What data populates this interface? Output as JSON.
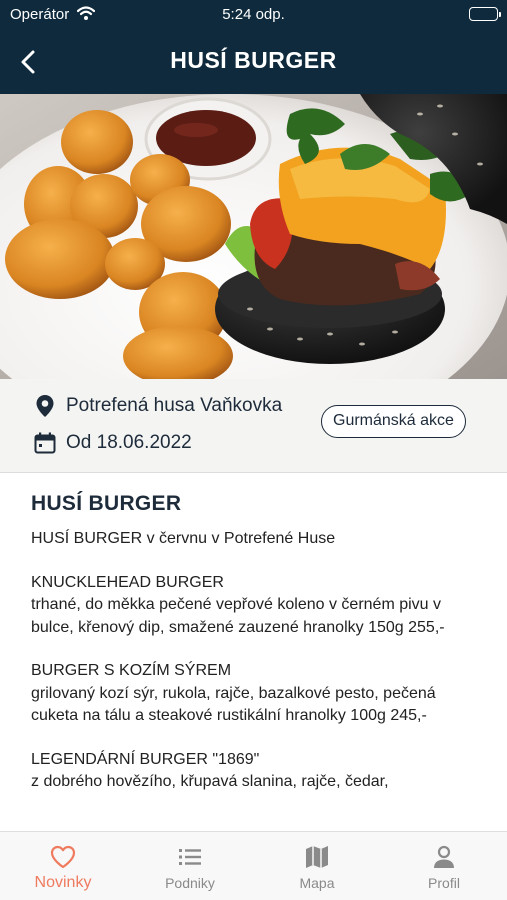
{
  "status": {
    "carrier": "Operátor",
    "time": "5:24 odp."
  },
  "nav": {
    "title": "HUSÍ BURGER"
  },
  "info": {
    "venue": "Potrefená husa Vaňkovka",
    "date": "Od 18.06.2022",
    "tag": "Gurmánská akce"
  },
  "article": {
    "heading": "HUSÍ BURGER",
    "paragraphs": [
      {
        "title": "HUSÍ BURGER v červnu v Potrefené Huse",
        "body": ""
      },
      {
        "title": "KNUCKLEHEAD BURGER",
        "body": "trhané, do měkka pečené vepřové koleno v černém pivu v bulce, křenový dip, smažené zauzené hranolky 150g 255,-"
      },
      {
        "title": "BURGER S KOZÍM SÝREM",
        "body": "grilovaný kozí sýr, rukola, rajče, bazalkové pesto, pečená cuketa na tálu a steakové rustikální hranolky 100g 245,-"
      },
      {
        "title": "LEGENDÁRNÍ BURGER \"1869\"",
        "body": "z dobrého hovězího, křupavá slanina, rajče, čedar,"
      }
    ]
  },
  "tabs": [
    {
      "label": "Novinky",
      "icon": "heart-icon",
      "active": true
    },
    {
      "label": "Podniky",
      "icon": "list-icon",
      "active": false
    },
    {
      "label": "Mapa",
      "icon": "map-icon",
      "active": false
    },
    {
      "label": "Profil",
      "icon": "person-icon",
      "active": false
    }
  ],
  "colors": {
    "header": "#0e2a3c",
    "accent": "#ef7b5f",
    "text": "#1d2b3a"
  }
}
